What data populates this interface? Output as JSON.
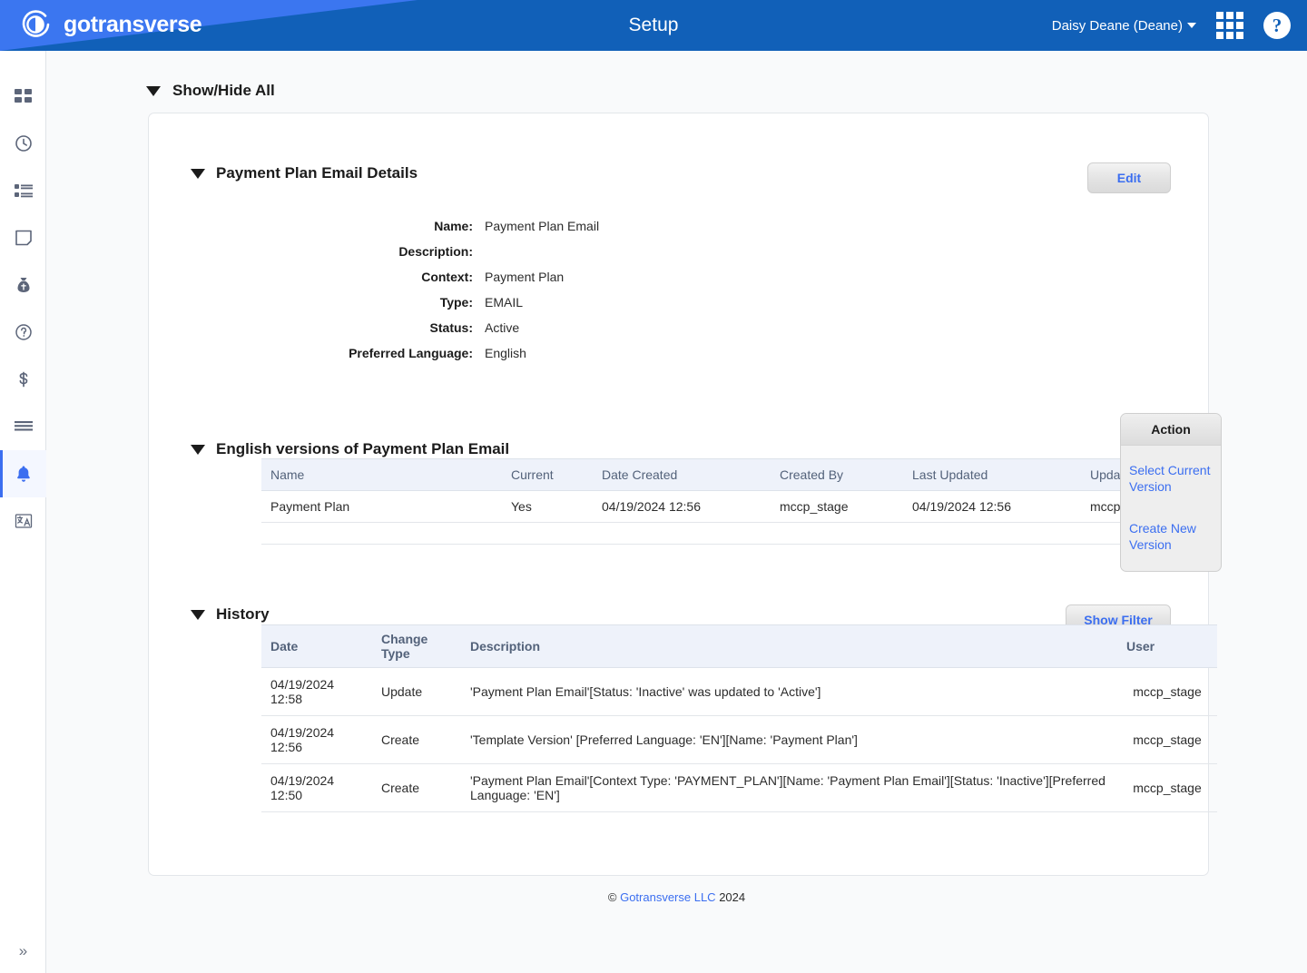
{
  "header": {
    "brand": "gotransverse",
    "brand_icon": "gotransverse-logo-icon",
    "title": "Setup",
    "user_menu": "Daisy Deane (Deane)",
    "apps_icon": "grid-apps-icon",
    "help_icon": "help-circle-icon",
    "colors": {
      "dark_blue": "#1160b8",
      "light_blue": "#3b76f0"
    }
  },
  "sidebar": {
    "items": [
      {
        "name": "dashboard",
        "icon": "dashboard-grid-icon",
        "active": false
      },
      {
        "name": "usage",
        "icon": "clock-icon",
        "active": false
      },
      {
        "name": "orders",
        "icon": "list-icon",
        "active": false
      },
      {
        "name": "documents",
        "icon": "page-icon",
        "active": false
      },
      {
        "name": "revenue",
        "icon": "money-bag-icon",
        "active": false
      },
      {
        "name": "support",
        "icon": "question-circle-icon",
        "active": false
      },
      {
        "name": "billing",
        "icon": "dollar-icon",
        "active": false
      },
      {
        "name": "reports",
        "icon": "menu-lines-icon",
        "active": false
      },
      {
        "name": "notifications",
        "icon": "bell-icon",
        "active": true
      },
      {
        "name": "translations",
        "icon": "language-icon",
        "active": false
      }
    ],
    "collapse_icon": "double-chevron-right-icon"
  },
  "main": {
    "show_hide_all": "Show/Hide All",
    "details_section": {
      "title": "Payment Plan Email Details",
      "edit_label": "Edit",
      "fields": [
        {
          "label": "Name:",
          "value": "Payment Plan Email"
        },
        {
          "label": "Description:",
          "value": ""
        },
        {
          "label": "Context:",
          "value": "Payment Plan"
        },
        {
          "label": "Type:",
          "value": "EMAIL"
        },
        {
          "label": "Status:",
          "value": "Active"
        },
        {
          "label": "Preferred Language:",
          "value": "English"
        }
      ]
    },
    "versions_section": {
      "title": "English versions of Payment Plan Email",
      "columns": [
        "Name",
        "Current",
        "Date Created",
        "Created By",
        "Last Updated",
        "Updated By"
      ],
      "rows": [
        {
          "name": "Payment Plan",
          "current": "Yes",
          "date_created": "04/19/2024 12:56",
          "created_by": "mccp_stage",
          "last_updated": "04/19/2024 12:56",
          "updated_by": "mccp_stage"
        }
      ],
      "action_panel": {
        "title": "Action",
        "links": [
          "Select Current Version",
          "Create New Version"
        ]
      }
    },
    "history_section": {
      "title": "History",
      "show_filter_label": "Show Filter",
      "columns": [
        "Date",
        "Change Type",
        "Description",
        "User"
      ],
      "rows": [
        {
          "date": "04/19/2024 12:58",
          "change_type": "Update",
          "description": "'Payment Plan Email'[Status: 'Inactive' was updated to 'Active']",
          "user": "mccp_stage"
        },
        {
          "date": "04/19/2024 12:56",
          "change_type": "Create",
          "description": "'Template Version' [Preferred Language: 'EN'][Name: 'Payment Plan']",
          "user": "mccp_stage"
        },
        {
          "date": "04/19/2024 12:50",
          "change_type": "Create",
          "description": "'Payment Plan Email'[Context Type: 'PAYMENT_PLAN'][Name: 'Payment Plan Email'][Status: 'Inactive'][Preferred Language: 'EN']",
          "user": "mccp_stage"
        }
      ]
    },
    "footer": {
      "copyright_symbol": "©",
      "company": "Gotransverse LLC",
      "year": "2024"
    }
  }
}
